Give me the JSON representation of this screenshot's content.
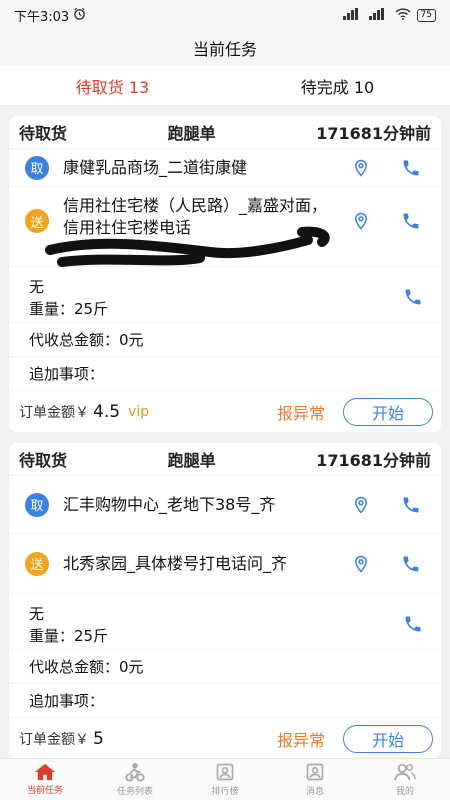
{
  "status_bar": {
    "time": "下午3:03",
    "battery": "75"
  },
  "header": {
    "title": "当前任务"
  },
  "tabs": [
    {
      "label": "待取货 13",
      "active": true
    },
    {
      "label": "待完成 10",
      "active": false
    }
  ],
  "orders": [
    {
      "status": "待取货",
      "type": "跑腿单",
      "time_ago": "171681分钟前",
      "pickup_badge": "取",
      "pickup_address": "康健乳品商场_二道街康健",
      "delivery_badge": "送",
      "delivery_address": "信用社住宅楼（人民路）_嘉盛对面，信用社住宅楼电话",
      "note": "无",
      "weight": "重量：25斤",
      "cod": "代收总金额：0元",
      "extra": "追加事项：",
      "amount_label": "订单金额￥",
      "amount": "4.5",
      "vip": "vip",
      "report_label": "报异常",
      "start_label": "开始"
    },
    {
      "status": "待取货",
      "type": "跑腿单",
      "time_ago": "171681分钟前",
      "pickup_badge": "取",
      "pickup_address": "汇丰购物中心_老地下38号_齐",
      "delivery_badge": "送",
      "delivery_address": "北秀家园_具体楼号打电话问_齐",
      "note": "无",
      "weight": "重量：25斤",
      "cod": "代收总金额：0元",
      "extra": "追加事项：",
      "amount_label": "订单金额￥",
      "amount": "5",
      "report_label": "报异常",
      "start_label": "开始"
    }
  ],
  "bottom_nav": [
    {
      "label": "当前任务",
      "icon": "home-icon",
      "active": true
    },
    {
      "label": "任务列表",
      "icon": "rider-icon",
      "active": false
    },
    {
      "label": "排行榜",
      "icon": "ranking-icon",
      "active": false
    },
    {
      "label": "消息",
      "icon": "message-icon",
      "active": false
    },
    {
      "label": "我的",
      "icon": "profile-icon",
      "active": false
    }
  ],
  "colors": {
    "accent_red": "#e33b2b",
    "pickup_blue": "#3b82e0",
    "delivery_orange": "#f2a51a",
    "report_orange": "#ea7b2a",
    "vip_gold": "#d79a1c"
  }
}
